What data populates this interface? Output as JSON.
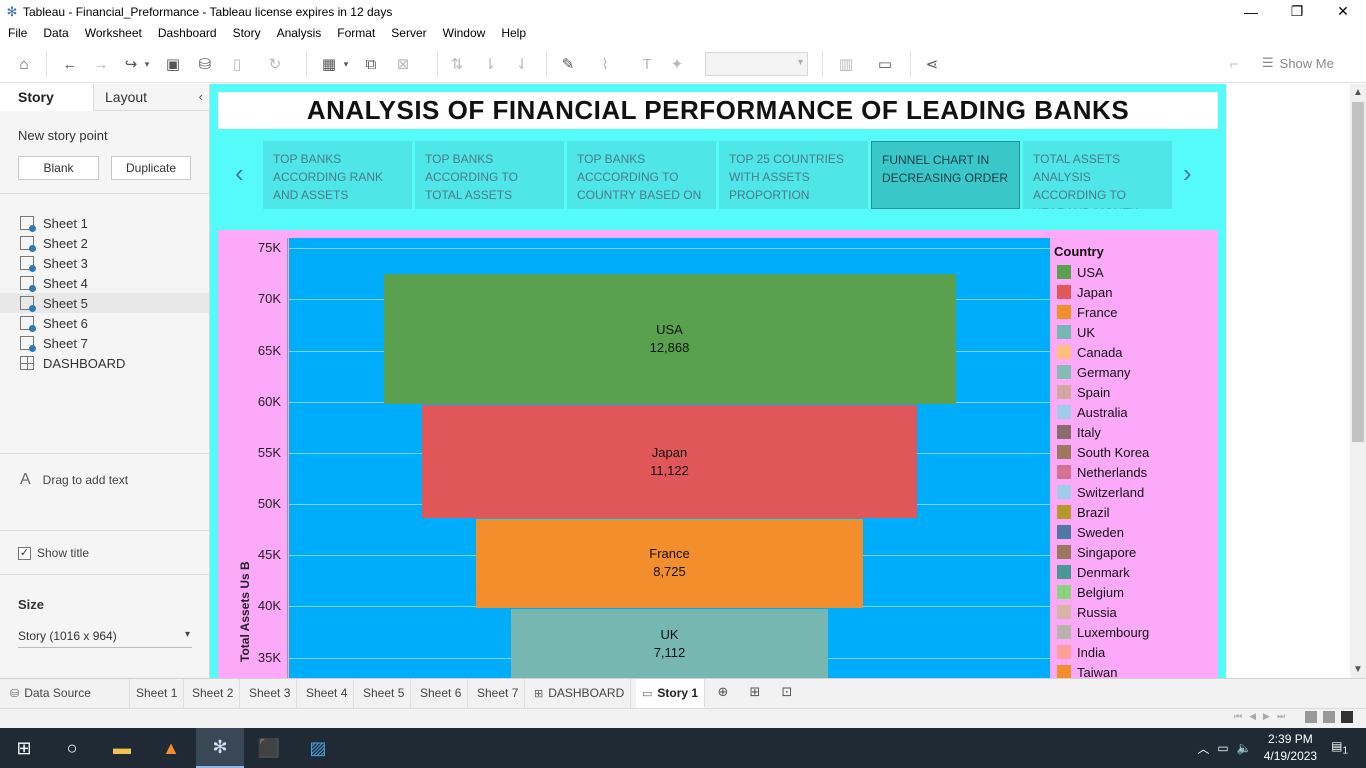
{
  "window": {
    "title": "Tableau - Financial_Preformance - Tableau license expires in 12 days",
    "controls": [
      "—",
      "❐",
      "✕"
    ]
  },
  "menu": [
    "File",
    "Data",
    "Worksheet",
    "Dashboard",
    "Story",
    "Analysis",
    "Format",
    "Server",
    "Window",
    "Help"
  ],
  "toolbar": {
    "show_me_label": "Show Me",
    "icons": [
      "home-icon",
      "undo-icon",
      "redo-icon",
      "replay-icon",
      "save-icon",
      "new-datasource-icon",
      "pause-icon",
      "refresh-icon",
      "new-worksheet-icon",
      "duplicate-icon",
      "clear-icon",
      "swap-icon",
      "sort-ascending-icon",
      "sort-descending-icon",
      "highlight-icon",
      "group-icon",
      "label-icon",
      "pin-icon",
      "fit-combo",
      "chart-type-icon",
      "presentation-icon",
      "share-icon",
      "paint-icon"
    ]
  },
  "left_panel": {
    "tabs": [
      "Story",
      "Layout"
    ],
    "new_story_point_label": "New story point",
    "blank_label": "Blank",
    "duplicate_label": "Duplicate",
    "sheets": [
      "Sheet 1",
      "Sheet 2",
      "Sheet 3",
      "Sheet 4",
      "Sheet 5",
      "Sheet 6",
      "Sheet 7",
      "DASHBOARD"
    ],
    "selected_sheet": "Sheet 5",
    "drag_text": "Drag to add text",
    "show_title_label": "Show title",
    "show_title_checked": true,
    "size_label": "Size",
    "size_value": "Story (1016 x 964)"
  },
  "story": {
    "title": "ANALYSIS OF FINANCIAL PERFORMANCE OF LEADING BANKS",
    "points": [
      "TOP BANKS ACCORDING RANK AND ASSETS",
      "TOP BANKS ACCORDING TO TOTAL ASSETS",
      "TOP BANKS ACCCORDING TO COUNTRY BASED ON",
      "TOP 25 COUNTRIES WITH ASSETS PROPORTION",
      "FUNNEL CHART IN DECREASING ORDER",
      "TOTAL ASSETS ANALYSIS ACCORDING TO YEARAND MONTH"
    ],
    "active_point": 4,
    "colors": {
      "canvas": "#55fbf8",
      "chart_background": "#fca9f9",
      "plot_background": "#00adfa",
      "active_point": "#39c7c9"
    }
  },
  "chart_data": {
    "type": "bar",
    "subtype": "funnel",
    "title": "",
    "ylabel": "Total Assets Us B",
    "ylim": [
      33000,
      76000
    ],
    "yticks": [
      "75K",
      "70K",
      "65K",
      "60K",
      "55K",
      "50K",
      "45K",
      "40K",
      "35K"
    ],
    "ytick_values": [
      75000,
      70000,
      65000,
      60000,
      55000,
      50000,
      45000,
      40000,
      35000
    ],
    "stack_top": 72500,
    "bars": [
      {
        "country": "USA",
        "value": 12868,
        "label": "12,868",
        "color": "#59a14f"
      },
      {
        "country": "Japan",
        "value": 11122,
        "label": "11,122",
        "color": "#e15759"
      },
      {
        "country": "France",
        "value": 8725,
        "label": "8,725",
        "color": "#f28e2b"
      },
      {
        "country": "UK",
        "value": 7112,
        "label": "7,112",
        "color": "#76b7b2"
      }
    ],
    "legend_title": "Country",
    "legend_position": "right",
    "legend": [
      {
        "name": "USA",
        "color": "#59a14f"
      },
      {
        "name": "Japan",
        "color": "#e15759"
      },
      {
        "name": "France",
        "color": "#f28e2b"
      },
      {
        "name": "UK",
        "color": "#76b7b2"
      },
      {
        "name": "Canada",
        "color": "#ffbe7d"
      },
      {
        "name": "Germany",
        "color": "#86bcb6"
      },
      {
        "name": "Spain",
        "color": "#d4a6a0"
      },
      {
        "name": "Australia",
        "color": "#a0cbe8"
      },
      {
        "name": "Italy",
        "color": "#8c6d6d"
      },
      {
        "name": "South Korea",
        "color": "#9d7660"
      },
      {
        "name": "Netherlands",
        "color": "#d37295"
      },
      {
        "name": "Switzerland",
        "color": "#a0cbe8"
      },
      {
        "name": "Brazil",
        "color": "#b6992d"
      },
      {
        "name": "Sweden",
        "color": "#4e79a7"
      },
      {
        "name": "Singapore",
        "color": "#9d7660"
      },
      {
        "name": "Denmark",
        "color": "#499894"
      },
      {
        "name": "Belgium",
        "color": "#8cd17d"
      },
      {
        "name": "Russia",
        "color": "#d7b5a6"
      },
      {
        "name": "Luxembourg",
        "color": "#bab0ac"
      },
      {
        "name": "India",
        "color": "#ff9d9a"
      },
      {
        "name": "Taiwan",
        "color": "#f28e2b"
      }
    ]
  },
  "sheet_tabs": [
    "Data Source",
    "Sheet 1",
    "Sheet 2",
    "Sheet 3",
    "Sheet 4",
    "Sheet 5",
    "Sheet 6",
    "Sheet 7",
    "DASHBOARD",
    "Story 1"
  ],
  "active_sheet_tab": "Story 1",
  "taskbar": {
    "time": "2:39 PM",
    "date": "4/19/2023",
    "notification_count": "1"
  }
}
